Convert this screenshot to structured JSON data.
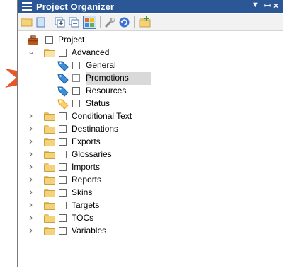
{
  "window": {
    "title": "Project Organizer",
    "controls": {
      "dropdown_icon": "chevron-down-icon",
      "pin_icon": "pin-icon",
      "close_icon": "close-icon"
    }
  },
  "toolbar": {
    "buttons": [
      {
        "name": "open-folder-button",
        "icon": "folder-open-icon"
      },
      {
        "name": "new-item-button",
        "icon": "document-icon"
      },
      {
        "name": "expand-all-button",
        "icon": "expand-all-icon"
      },
      {
        "name": "collapse-all-button",
        "icon": "collapse-all-icon"
      },
      {
        "name": "view-button",
        "icon": "grid-view-icon"
      },
      {
        "name": "tools-button",
        "icon": "wrench-icon"
      },
      {
        "name": "refresh-button",
        "icon": "refresh-icon"
      },
      {
        "name": "add-folder-button",
        "icon": "add-folder-icon"
      }
    ]
  },
  "tree": {
    "root": {
      "label": "Project",
      "icon": "briefcase-icon"
    },
    "advanced": {
      "label": "Advanced",
      "expanded": true,
      "children": [
        {
          "label": "General",
          "icon": "blue-tag-icon"
        },
        {
          "label": "Promotions",
          "icon": "blue-tag-icon",
          "selected": true
        },
        {
          "label": "Resources",
          "icon": "blue-tag-icon"
        },
        {
          "label": "Status",
          "icon": "orange-tag-icon"
        }
      ]
    },
    "folders": [
      {
        "label": "Conditional Text"
      },
      {
        "label": "Destinations"
      },
      {
        "label": "Exports"
      },
      {
        "label": "Glossaries"
      },
      {
        "label": "Imports"
      },
      {
        "label": "Reports"
      },
      {
        "label": "Skins"
      },
      {
        "label": "Targets"
      },
      {
        "label": "TOCs"
      },
      {
        "label": "Variables"
      }
    ]
  },
  "colors": {
    "titlebar": "#2b5797",
    "callout_arrow": "#e8562a",
    "selection": "#d9d9d9",
    "tag_blue": "#3b8fd6",
    "tag_orange": "#f0a020",
    "folder": "#f3d27a"
  }
}
